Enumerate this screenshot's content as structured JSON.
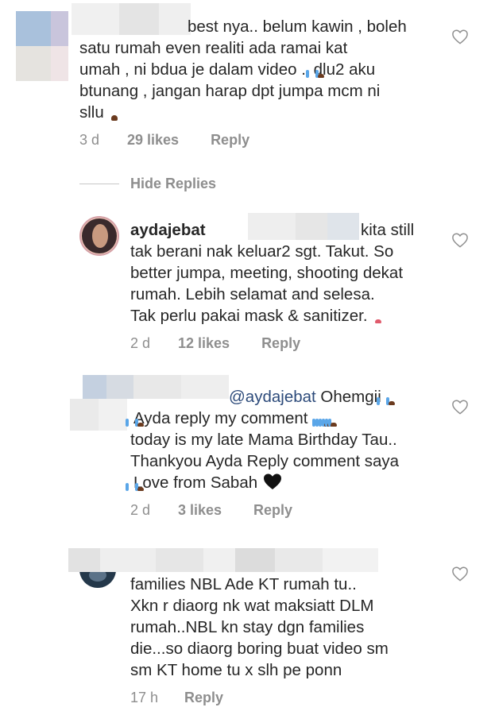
{
  "comments": [
    {
      "lines": [
        "best nya.. belum kawin , boleh",
        "satu rumah even realiti ada ramai kat",
        "umah , ni bdua je dalam video .",
        "dlu2 aku",
        "btunang , jangan harap dpt jumpa mcm ni",
        "sllu"
      ],
      "time": "3 d",
      "likes": "29 likes",
      "reply": "Reply"
    },
    {
      "username": "aydajebat",
      "lines": [
        "kita still",
        "tak berani nak keluar2 sgt. Takut. So",
        "better jumpa, meeting, shooting dekat",
        "rumah. Lebih selamat and selesa.",
        "Tak perlu pakai mask & sanitizer."
      ],
      "time": "2 d",
      "likes": "12 likes",
      "reply": "Reply"
    },
    {
      "mention": "@aydajebat",
      "lines": [
        "Ohemgii",
        "Ayda reply my comment .",
        "today is my late Mama Birthday Tau..",
        "Thankyou Ayda Reply comment saya",
        "Love from Sabah"
      ],
      "time": "2 d",
      "likes": "3 likes",
      "reply": "Reply"
    },
    {
      "lines": [
        "families NBL Ade KT rumah tu..",
        "Xkn r diaorg nk wat maksiatt DLM",
        "rumah..NBL kn stay dgn families",
        "die...so diaorg boring buat video sm",
        "sm KT home tu x slh pe ponn"
      ],
      "time": "17 h",
      "reply": "Reply"
    }
  ],
  "hide_replies": "Hide Replies",
  "icons": {
    "heart": "heart-outline-icon",
    "verified": "verified-badge-icon"
  },
  "colors": {
    "text": "#262626",
    "meta": "#8e8e8e",
    "mention": "#2c4a7a",
    "verified": "#3897f0"
  }
}
